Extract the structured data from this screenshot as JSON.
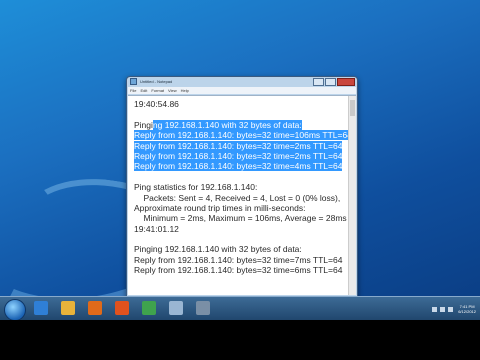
{
  "window": {
    "title": "Untitled - Notepad",
    "menus": [
      "File",
      "Edit",
      "Format",
      "View",
      "Help"
    ]
  },
  "editor_lines": [
    {
      "text": "19:40:54.86",
      "highlight": "none"
    },
    {
      "text": "",
      "highlight": "none"
    },
    {
      "text": "Pinging 192.168.1.140 with 32 bytes of data:",
      "highlight": "partial",
      "prefix": "Pingi",
      "selected": "ng 192.168.1.140 with 32 bytes of data:"
    },
    {
      "text": "Reply from 192.168.1.140: bytes=32 time=106ms TTL=64",
      "highlight": "full"
    },
    {
      "text": "Reply from 192.168.1.140: bytes=32 time=2ms TTL=64",
      "highlight": "full"
    },
    {
      "text": "Reply from 192.168.1.140: bytes=32 time=2ms TTL=64",
      "highlight": "full"
    },
    {
      "text": "Reply from 192.168.1.140: bytes=32 time=4ms TTL=64",
      "highlight": "full"
    },
    {
      "text": "",
      "highlight": "none"
    },
    {
      "text": "Ping statistics for 192.168.1.140:",
      "highlight": "none"
    },
    {
      "text": "    Packets: Sent = 4, Received = 4, Lost = 0 (0% loss),",
      "highlight": "none"
    },
    {
      "text": "Approximate round trip times in milli-seconds:",
      "highlight": "none"
    },
    {
      "text": "    Minimum = 2ms, Maximum = 106ms, Average = 28ms",
      "highlight": "none"
    },
    {
      "text": "19:41:01.12",
      "highlight": "none"
    },
    {
      "text": "",
      "highlight": "none"
    },
    {
      "text": "Pinging 192.168.1.140 with 32 bytes of data:",
      "highlight": "none"
    },
    {
      "text": "Reply from 192.168.1.140: bytes=32 time=7ms TTL=64",
      "highlight": "none"
    },
    {
      "text": "Reply from 192.168.1.140: bytes=32 time=6ms TTL=64",
      "highlight": "none"
    }
  ],
  "taskbar": {
    "clock_time": "7:41 PM",
    "clock_date": "6/12/2012",
    "pinned_icons": [
      "ie-icon",
      "explorer-icon",
      "media-player-icon",
      "firefox-icon",
      "chrome-icon",
      "notepad-icon",
      "app-icon"
    ]
  },
  "colors": {
    "selection": "#3399ff",
    "desktop": "#1b6fc0"
  }
}
